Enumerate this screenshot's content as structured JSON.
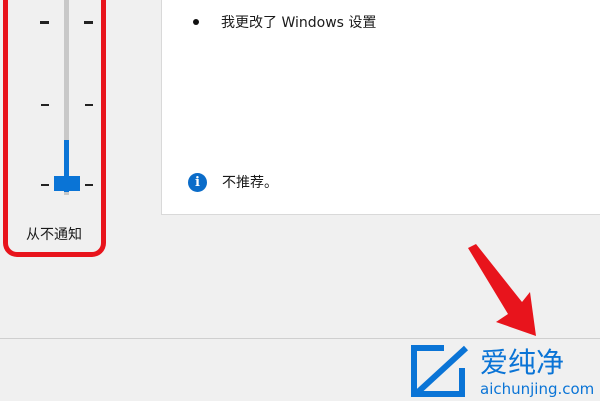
{
  "slider": {
    "caption": "从不通知",
    "level": 0,
    "levels_total": 4
  },
  "content": {
    "bullet_text": "我更改了 Windows 设置",
    "info_text": "不推荐。"
  },
  "colors": {
    "accent": "#0a74d6",
    "annotation_red": "#e8141c",
    "info_blue": "#0a6cc9"
  },
  "icons": {
    "info": "info-icon",
    "arrow": "red-arrow-annotation"
  },
  "watermark": {
    "brand": "爱纯净",
    "url": "aichunjing.com"
  }
}
